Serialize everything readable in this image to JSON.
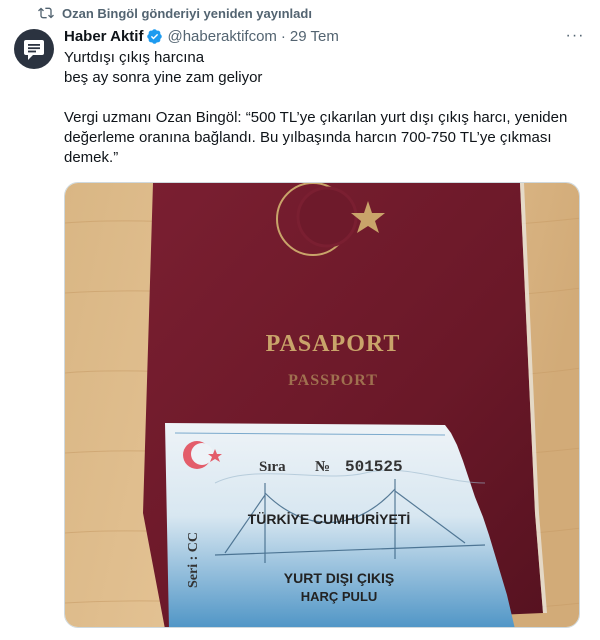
{
  "repost": {
    "text": "Ozan Bingöl gönderiyi yeniden yayınladı",
    "icon": "repost-icon"
  },
  "tweet": {
    "author": "Haber Aktif",
    "handle": "@haberaktifcom",
    "separator": "·",
    "time": "29 Tem",
    "more": "···",
    "text": "Yurtdışı çıkış harcına\nbeş ay sonra yine zam geliyor\n\nVergi uzmanı Ozan Bingöl: “500 TL’ye çıkarılan yurt dışı çıkış harcı, yeniden değerleme oranına bağlandı. Bu yılbaşında harcın 700-750 TL’ye çıkması demek.”"
  },
  "media": {
    "passport_title": "PASAPORT",
    "passport_subtitle": "PASSPORT",
    "stamp_sira": "Sıra",
    "stamp_no": "№",
    "stamp_number": "501525",
    "stamp_country": "TÜRKİYE CUMHURİYETİ",
    "stamp_line1": "YURT DIŞI ÇIKIŞ",
    "stamp_line2": "HARÇ PULU",
    "stamp_seri": "Seri : CC"
  },
  "colors": {
    "accent": "#1d9bf0",
    "text_secondary": "#536471",
    "passport": "#6e1a2b",
    "gold": "#c9a46a"
  }
}
